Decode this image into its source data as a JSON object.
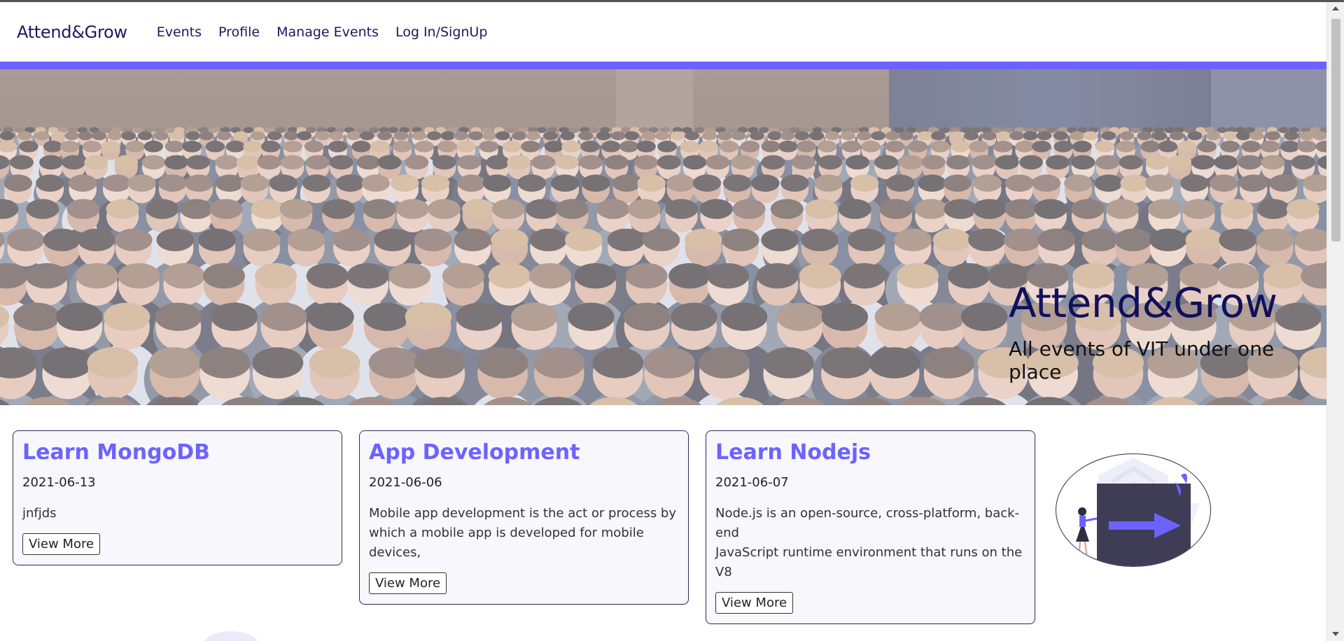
{
  "navbar": {
    "brand": "Attend&Grow",
    "links": [
      "Events",
      "Profile",
      "Manage Events",
      "Log In/SignUp"
    ]
  },
  "hero": {
    "title": "Attend&Grow",
    "subtitle": "All events of VIT under one place",
    "image": "conference-audience-photo"
  },
  "events": [
    {
      "title": "Learn MongoDB",
      "date": "2021-06-13",
      "description": [
        "jnfjds"
      ],
      "button": "View More"
    },
    {
      "title": "App Development",
      "date": "2021-06-06",
      "description": [
        "Mobile app development is the act or process by",
        "which a mobile app is developed for mobile devices,"
      ],
      "button": "View More"
    },
    {
      "title": "Learn Nodejs",
      "date": "2021-06-07",
      "description": [
        "Node.js is an open-source, cross-platform, back-end",
        "JavaScript runtime environment that runs on the V8"
      ],
      "button": "View More"
    }
  ],
  "colors": {
    "accent": "#6c63ff",
    "brand_text": "#1a1a5e",
    "card_border": "#2a2a5a"
  },
  "icons": [
    "arrow-right-icon",
    "person-icon"
  ]
}
